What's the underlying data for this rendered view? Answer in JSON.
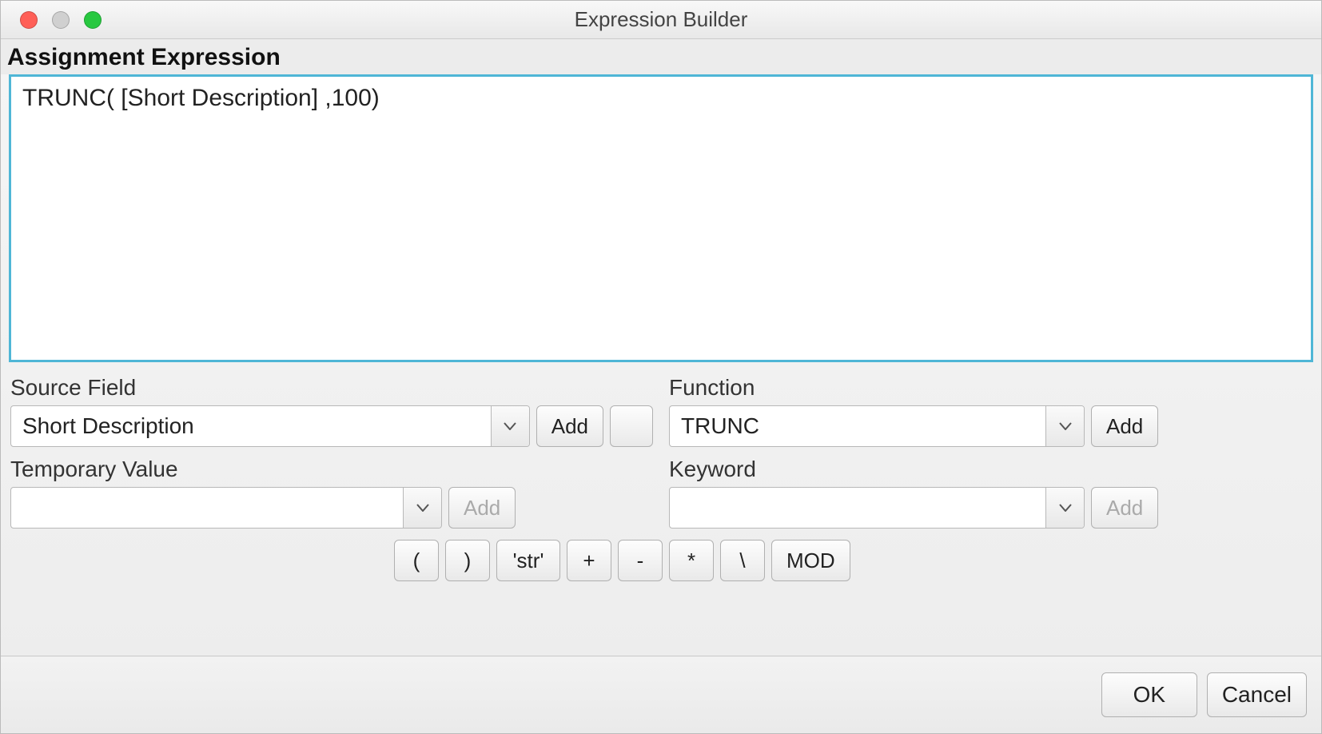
{
  "window": {
    "title": "Expression Builder"
  },
  "section": {
    "assignment_label": "Assignment Expression"
  },
  "expression": {
    "value": "TRUNC( [Short Description] ,100)"
  },
  "fields": {
    "source_field": {
      "label": "Source Field",
      "value": "Short Description",
      "add_label": "Add"
    },
    "function": {
      "label": "Function",
      "value": "TRUNC",
      "add_label": "Add"
    },
    "temporary_value": {
      "label": "Temporary Value",
      "value": "",
      "add_label": "Add"
    },
    "keyword": {
      "label": "Keyword",
      "value": "",
      "add_label": "Add"
    }
  },
  "operators": {
    "open_paren": "(",
    "close_paren": ")",
    "str": "'str'",
    "plus": "+",
    "minus": "-",
    "mult": "*",
    "backslash": "\\",
    "mod": "MOD"
  },
  "footer": {
    "ok": "OK",
    "cancel": "Cancel"
  }
}
